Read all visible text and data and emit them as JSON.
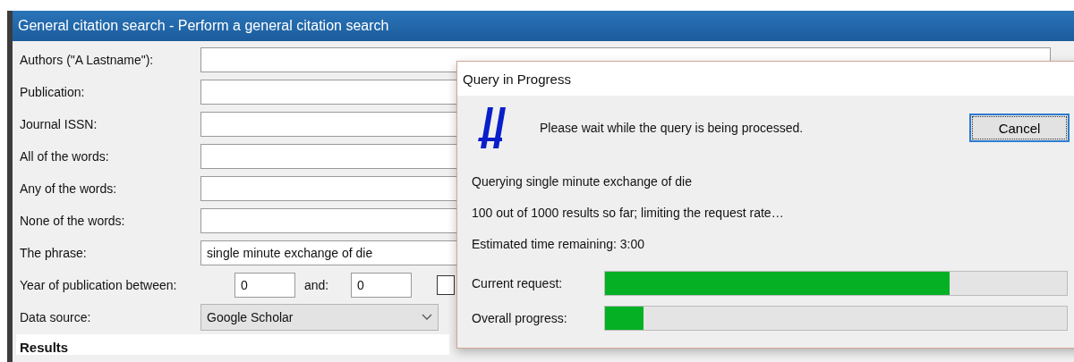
{
  "window": {
    "title": "General citation search - Perform a general citation search"
  },
  "fields": [
    {
      "label": "Authors (\"A Lastname\"):"
    },
    {
      "label": "Publication:"
    },
    {
      "label": "Journal ISSN:"
    },
    {
      "label": "All of the words:"
    },
    {
      "label": "Any of the words:"
    },
    {
      "label": "None of the words:"
    },
    {
      "label": "The phrase:",
      "value": "single minute exchange of die"
    }
  ],
  "year": {
    "label": "Year of publication between:",
    "from": "0",
    "and_label": "and:",
    "to": "0",
    "checked": false
  },
  "data_source": {
    "label": "Data source:",
    "value": "Google Scholar"
  },
  "results": {
    "heading": "Results"
  },
  "dialog": {
    "title": "Query in Progress",
    "message": "Please wait while the query is being processed.",
    "cancel": "Cancel",
    "lines": [
      "Querying single minute exchange of die",
      "100 out of 1000 results so far; limiting the request rate…",
      "Estimated time remaining: 3:00"
    ],
    "progress": [
      {
        "label": "Current request:",
        "level": 0.746
      },
      {
        "label": "Overall progress:",
        "level": 0.083
      }
    ]
  }
}
